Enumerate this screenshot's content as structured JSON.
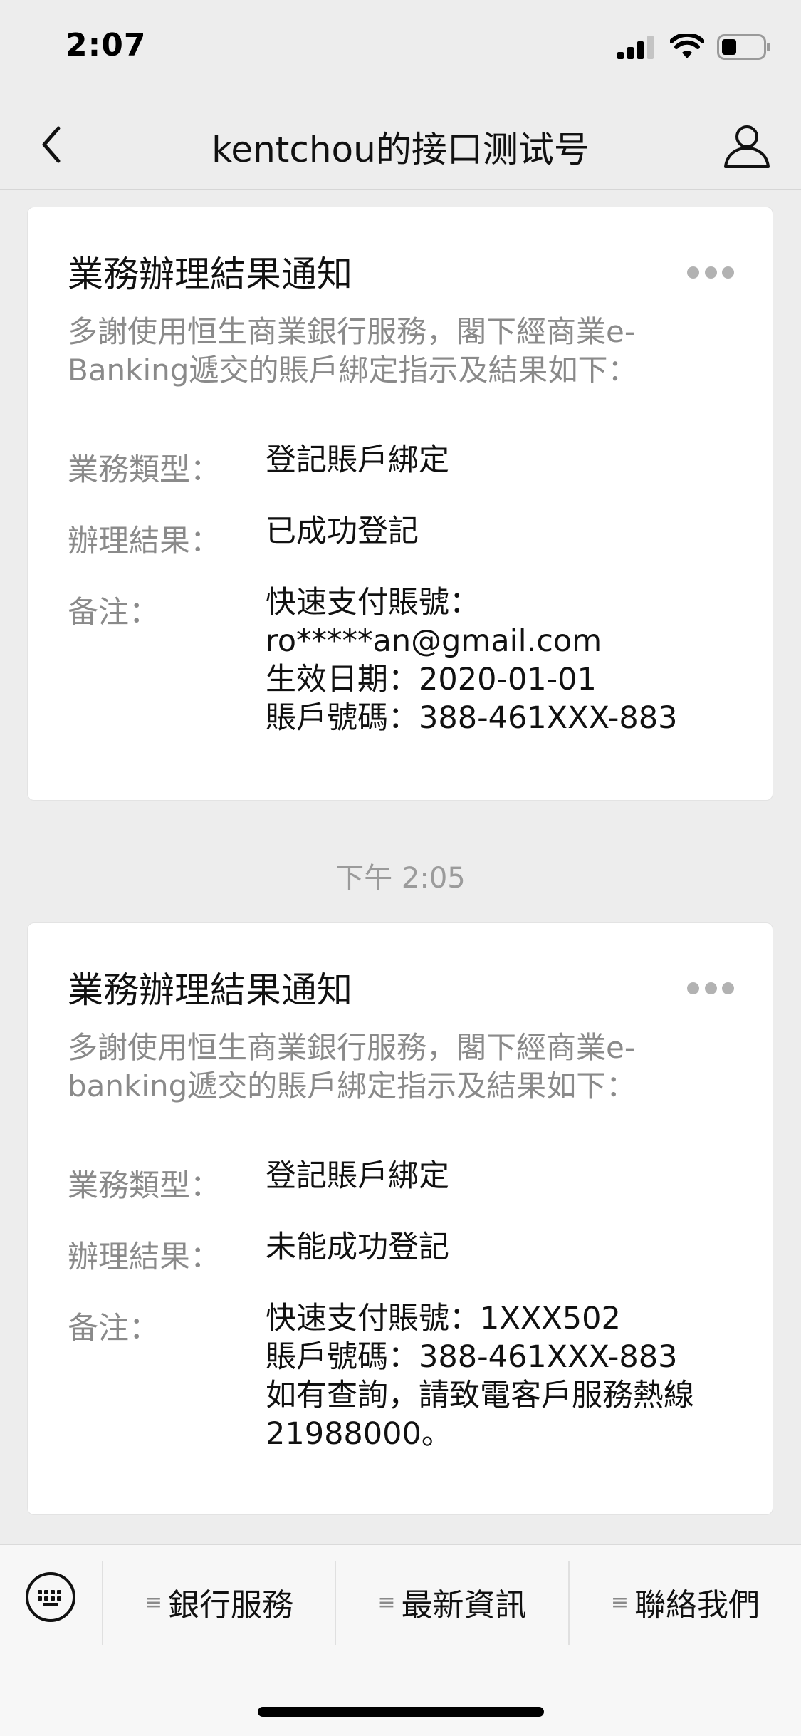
{
  "status_bar": {
    "time": "2:07"
  },
  "nav": {
    "title": "kentchou的接口测试号"
  },
  "cards": [
    {
      "title": "業務辦理結果通知",
      "intro": "多謝使用恒生商業銀行服務，閣下經商業e-Banking遞交的賬戶綁定指示及結果如下：",
      "type_label": "業務類型：",
      "type_value": "登記賬戶綁定",
      "result_label": "辦理結果：",
      "result_value": "已成功登記",
      "note_label": "备注：",
      "note_lines": [
        "快速支付賬號：",
        "ro*****an@gmail.com",
        "生效日期：2020-01-01",
        "賬戶號碼：388-461XXX-883"
      ]
    },
    {
      "title": "業務辦理結果通知",
      "intro": "多謝使用恒生商業銀行服務，閣下經商業e-banking遞交的賬戶綁定指示及結果如下：",
      "type_label": "業務類型：",
      "type_value": "登記賬戶綁定",
      "result_label": "辦理結果：",
      "result_value": "未能成功登記",
      "note_label": "备注：",
      "note_lines": [
        "快速支付賬號：1XXX502",
        "賬戶號碼：388-461XXX-883",
        "如有查詢，請致電客戶服務熱線",
        "21988000。"
      ]
    }
  ],
  "timestamp": "下午 2:05",
  "menu": {
    "items": [
      {
        "label": "銀行服務"
      },
      {
        "label": "最新資訊"
      },
      {
        "label": "聯絡我們"
      }
    ]
  },
  "colors": {
    "background": "#ededed",
    "card": "#ffffff",
    "muted_text": "#8a8a8a"
  }
}
